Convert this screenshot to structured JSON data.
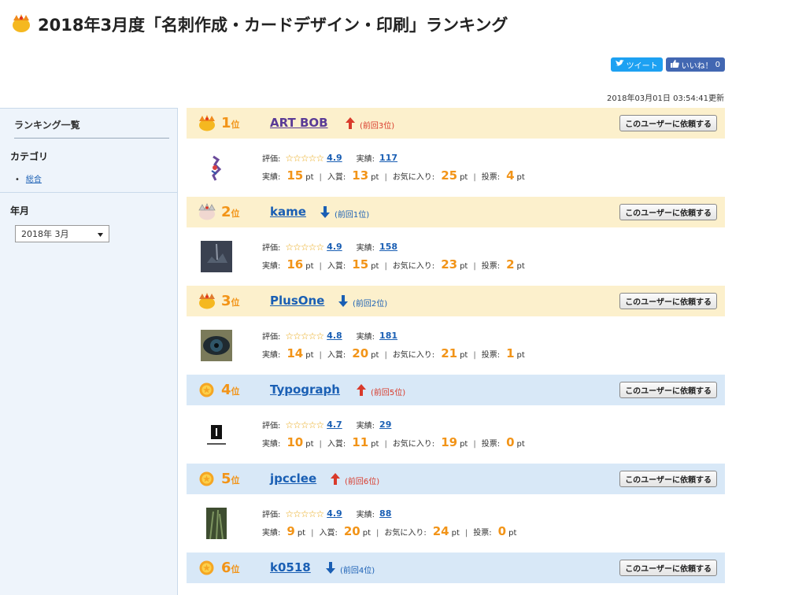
{
  "page_title": "2018年3月度「名刺作成・カードデザイン・印刷」ランキング",
  "social": {
    "tweet_label": "ツイート",
    "like_label": "いいね！",
    "like_count": "0"
  },
  "updated": "2018年03月01日 03:54:41更新",
  "sidebar": {
    "heading": "ランキング一覧",
    "category_title": "カテゴリ",
    "category_link": "総合",
    "month_title": "年月",
    "month_value": "2018年 3月"
  },
  "labels": {
    "rank_suffix": "位",
    "hyoka": "評価:",
    "jisseki": "実績:",
    "jisseki_pt": "実績:",
    "nyusho": "入賞:",
    "okiniiri": "お気に入り:",
    "tohyo": "投票:",
    "pt": "pt",
    "request_button": "このユーザーに依頼する"
  },
  "colors": {
    "gold_row": "#fcf0cc",
    "blue_row": "#d8e8f7",
    "accent_orange": "#f29418",
    "link_blue": "#1a5fb4",
    "up_red": "#d93a2b"
  },
  "rankings": [
    {
      "rank": "1",
      "name": "ART BOB",
      "trend": "up",
      "prev": "(前回3位)",
      "rating": "4.9",
      "works": "117",
      "stars": "☆☆☆☆☆",
      "pt_jisseki": "15",
      "pt_nyusho": "13",
      "pt_okiniiri": "25",
      "pt_tohyo": "4"
    },
    {
      "rank": "2",
      "name": "kame",
      "trend": "down",
      "prev": "(前回1位)",
      "rating": "4.9",
      "works": "158",
      "stars": "☆☆☆☆☆",
      "pt_jisseki": "16",
      "pt_nyusho": "15",
      "pt_okiniiri": "23",
      "pt_tohyo": "2"
    },
    {
      "rank": "3",
      "name": "PlusOne",
      "trend": "down",
      "prev": "(前回2位)",
      "rating": "4.8",
      "works": "181",
      "stars": "☆☆☆☆☆",
      "pt_jisseki": "14",
      "pt_nyusho": "20",
      "pt_okiniiri": "21",
      "pt_tohyo": "1"
    },
    {
      "rank": "4",
      "name": "Typograph",
      "trend": "up",
      "prev": "(前回5位)",
      "rating": "4.7",
      "works": "29",
      "stars": "☆☆☆☆☆",
      "pt_jisseki": "10",
      "pt_nyusho": "11",
      "pt_okiniiri": "19",
      "pt_tohyo": "0"
    },
    {
      "rank": "5",
      "name": "jpcclee",
      "trend": "up",
      "prev": "(前回6位)",
      "rating": "4.9",
      "works": "88",
      "stars": "☆☆☆☆☆",
      "pt_jisseki": "9",
      "pt_nyusho": "20",
      "pt_okiniiri": "24",
      "pt_tohyo": "0"
    },
    {
      "rank": "6",
      "name": "k0518",
      "trend": "down",
      "prev": "(前回4位)"
    }
  ]
}
